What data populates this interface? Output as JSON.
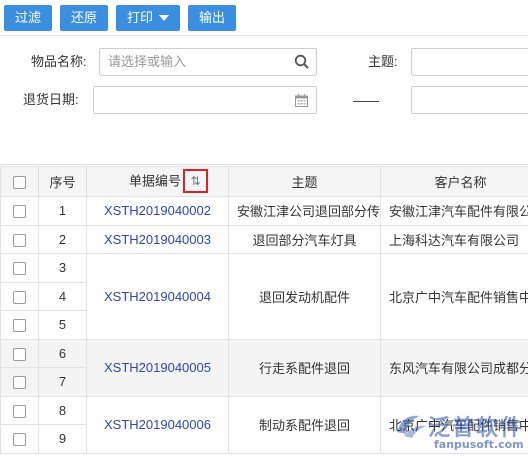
{
  "toolbar": {
    "filter_label": "过滤",
    "restore_label": "还原",
    "print_label": "打印",
    "export_label": "输出"
  },
  "filters": {
    "item_name_label": "物品名称:",
    "item_name_placeholder": "请选择或输入",
    "subject_label": "主题:",
    "return_date_label": "退货日期:"
  },
  "grid": {
    "columns": {
      "index": "序号",
      "doc_no": "单据编号",
      "sort_icon": "⇅",
      "subject": "主题",
      "customer": "客户名称"
    },
    "rows": [
      {
        "n": "1",
        "doc": "XSTH2019040002",
        "subject": "安徽江津公司退回部分传",
        "customer": "安徽江津汽车配件有限公"
      },
      {
        "n": "2",
        "doc": "XSTH2019040003",
        "subject": "退回部分汽车灯具",
        "customer": "上海科达汽车有限公司"
      },
      {
        "n": "3",
        "doc": "XSTH2019040004",
        "subject": "退回发动机配件",
        "customer": "北京广中汽车配件销售中"
      },
      {
        "n": "4"
      },
      {
        "n": "5"
      },
      {
        "n": "6",
        "doc": "XSTH2019040005",
        "subject": "行走系配件退回",
        "customer": "东风汽车有限公司成都分"
      },
      {
        "n": "7"
      },
      {
        "n": "8",
        "doc": "XSTH2019040006",
        "subject": "制动系配件退回",
        "customer": "北京广中汽车配件销售中"
      },
      {
        "n": "9"
      }
    ]
  },
  "watermark": {
    "brand": "泛普软件",
    "url": "fanpusoft.com"
  }
}
